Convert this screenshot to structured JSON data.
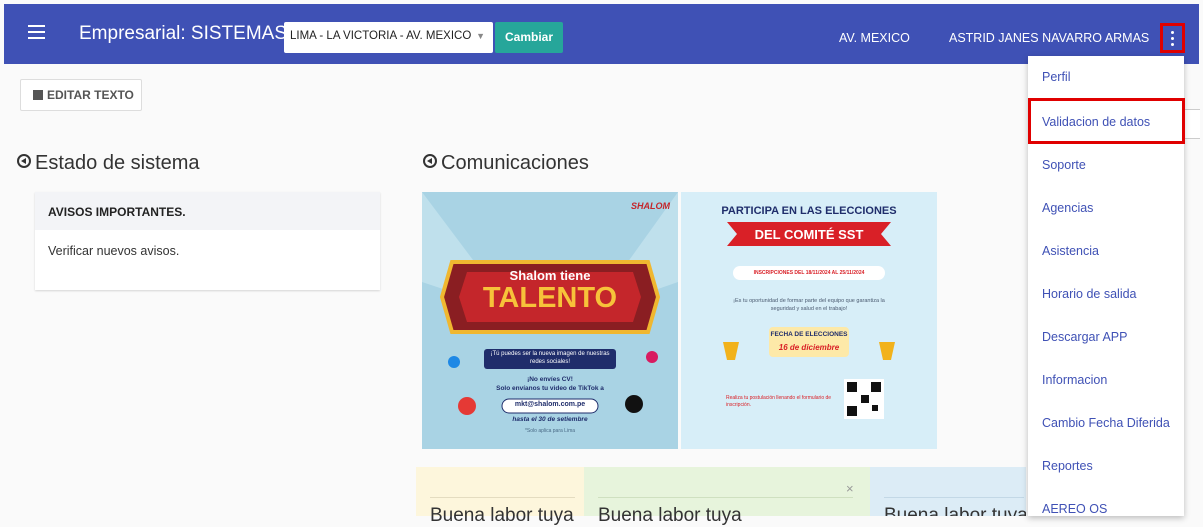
{
  "header": {
    "title": "Empresarial: SISTEMAS",
    "location_select": "LIMA - LA VICTORIA - AV. MEXICO",
    "change_button": "Cambiar",
    "branch": "AV. MEXICO",
    "user": "ASTRID JANES NAVARRO ARMAS",
    "colors": {
      "primary": "#3f51b5",
      "accent": "#26a69a",
      "highlight": "#e00000"
    }
  },
  "toolbar": {
    "edit_label": "EDITAR TEXTO"
  },
  "estado": {
    "title": "Estado de sistema",
    "card_header": "AVISOS IMPORTANTES.",
    "card_body": "Verificar nuevos avisos."
  },
  "comunicaciones": {
    "title": "Comunicaciones",
    "banner1": {
      "brand": "SHALOM",
      "line1": "Shalom tiene",
      "line2": "TALENTO",
      "pill": "¡Tú puedes ser la nueva imagen de nuestras redes sociales!",
      "cta1": "¡No envíes CV!",
      "cta2": "Solo envíanos tu video de TikTok a",
      "email": "mkt@shalom.com.pe",
      "deadline": "hasta el 30 de setiembre",
      "note": "*Solo aplica para Lima"
    },
    "banner2": {
      "title": "PARTICIPA EN LAS ELECCIONES",
      "ribbon": "DEL COMITÉ SST",
      "inscripciones": "INSCRIPCIONES DEL 18/11/2024 AL 25/11/2024",
      "desc": "¡Es tu oportunidad de formar parte del equipo que garantiza la seguridad y salud en el trabajo!",
      "fecha_label": "FECHA DE ELECCIONES",
      "fecha_value": "16 de diciembre",
      "postula": "Realiza tu postulación llenando el formulario de inscripción."
    },
    "bottom_cards": [
      "Buena labor tuya",
      "Buena labor tuya",
      "Buena labor tuya"
    ]
  },
  "menu": {
    "items": [
      "Perfil",
      "Validacion de datos",
      "Soporte",
      "Agencias",
      "Asistencia",
      "Horario de salida",
      "Descargar APP",
      "Informacion",
      "Cambio Fecha Diferida",
      "Reportes",
      "AEREO OS"
    ]
  }
}
